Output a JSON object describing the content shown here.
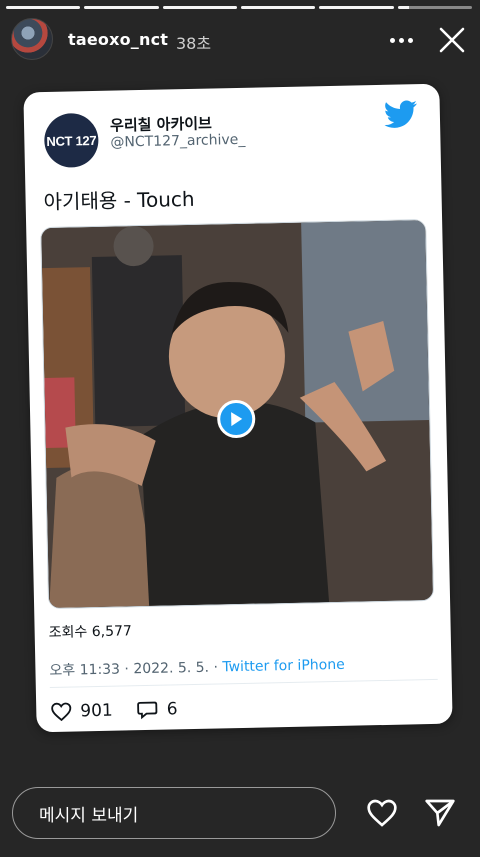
{
  "story": {
    "progress": [
      1,
      1,
      1,
      1,
      1,
      0.15
    ],
    "username": "taeoxo_nct",
    "time_ago": "38초"
  },
  "tweet": {
    "avatar_text": "NCT 127",
    "display_name": "우리칠 아카이브",
    "handle": "@NCT127_archive_",
    "text": "아기태용 - Touch",
    "views": "조회수 6,577",
    "time": "오후 11:33",
    "date": "2022. 5. 5.",
    "source": "Twitter for iPhone",
    "likes": "901",
    "replies": "6"
  },
  "footer": {
    "message_placeholder": "메시지 보내기"
  },
  "colors": {
    "twitter_blue": "#1d9bf0",
    "background": "#262626"
  },
  "icons": [
    "more-icon",
    "close-icon",
    "twitter-bird-icon",
    "play-icon",
    "heart-outline-icon",
    "reply-icon",
    "send-icon"
  ]
}
